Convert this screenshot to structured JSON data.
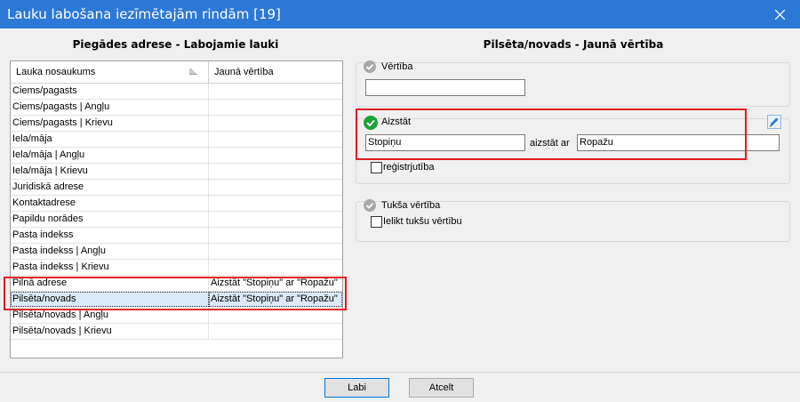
{
  "window": {
    "title": "Lauku labošana iezīmētajām rindām [19]"
  },
  "left_panel": {
    "title": "Piegādes adrese - Labojamie lauki",
    "columns": [
      "Lauka nosaukums",
      "Jaunā vērtība"
    ],
    "rows": [
      {
        "name": "Ciems/pagasts",
        "value": ""
      },
      {
        "name": "Ciems/pagasts | Angļu",
        "value": ""
      },
      {
        "name": "Ciems/pagasts | Krievu",
        "value": ""
      },
      {
        "name": "Iela/māja",
        "value": ""
      },
      {
        "name": "Iela/māja | Angļu",
        "value": ""
      },
      {
        "name": "Iela/māja | Krievu",
        "value": ""
      },
      {
        "name": "Juridiskā adrese",
        "value": ""
      },
      {
        "name": "Kontaktadrese",
        "value": ""
      },
      {
        "name": "Papildu norādes",
        "value": ""
      },
      {
        "name": "Pasta indekss",
        "value": ""
      },
      {
        "name": "Pasta indekss | Angļu",
        "value": ""
      },
      {
        "name": "Pasta indekss | Krievu",
        "value": ""
      },
      {
        "name": "Pilnā adrese",
        "value": "Aizstāt \"Stopiņu\" ar \"Ropažu\""
      },
      {
        "name": "Pilsēta/novads",
        "value": "Aizstāt \"Stopiņu\" ar \"Ropažu\"",
        "selected": true
      },
      {
        "name": "Pilsēta/novads | Angļu",
        "value": ""
      },
      {
        "name": "Pilsēta/novads | Krievu",
        "value": ""
      }
    ]
  },
  "right_panel": {
    "title": "Pilsēta/novads - Jaunā vērtība",
    "value_group": {
      "label": "Vērtība",
      "value": ""
    },
    "replace_group": {
      "label": "Aizstāt",
      "find_value": "Stopiņu",
      "replace_label": "aizstāt ar",
      "replace_value": "Ropažu",
      "case_label": "reģistrjutība",
      "case_checked": false
    },
    "empty_group": {
      "label": "Tukša vērtība",
      "checkbox_label": "Ielikt tukšu vērtību",
      "checked": false
    }
  },
  "buttons": {
    "ok": "Labi",
    "cancel": "Atcelt"
  },
  "icons": {
    "close": "close-icon",
    "sort": "sort-icon",
    "check": "check-circle-icon",
    "edit": "pencil-icon"
  },
  "colors": {
    "titlebar": "#2b78d6",
    "highlight": "#e01b24",
    "active_check": "#1fa336",
    "inactive_check": "#a8a8a8",
    "selected_row": "#dbe9f8"
  }
}
